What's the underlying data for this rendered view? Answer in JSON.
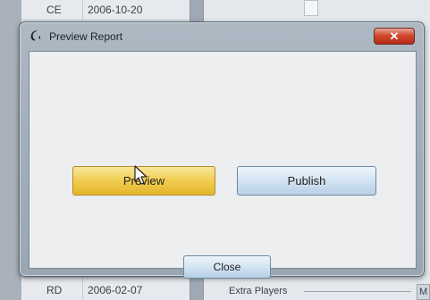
{
  "background": {
    "rows": [
      {
        "code": "CE",
        "date": "2006-10-20"
      },
      {
        "code": "RD",
        "date": "2006-02-07"
      }
    ],
    "extra_players_label": "Extra Players",
    "corner_label": "M"
  },
  "dialog": {
    "title": "Preview Report",
    "close_x": "✕",
    "buttons": {
      "preview": "Preview",
      "publish": "Publish",
      "close": "Close"
    }
  },
  "colors": {
    "preview_button": "#f1cd4f",
    "publish_button": "#d3e4f2",
    "close_x_button": "#d2492f"
  },
  "icons": [
    "app-icon",
    "pointer-cursor-icon"
  ]
}
